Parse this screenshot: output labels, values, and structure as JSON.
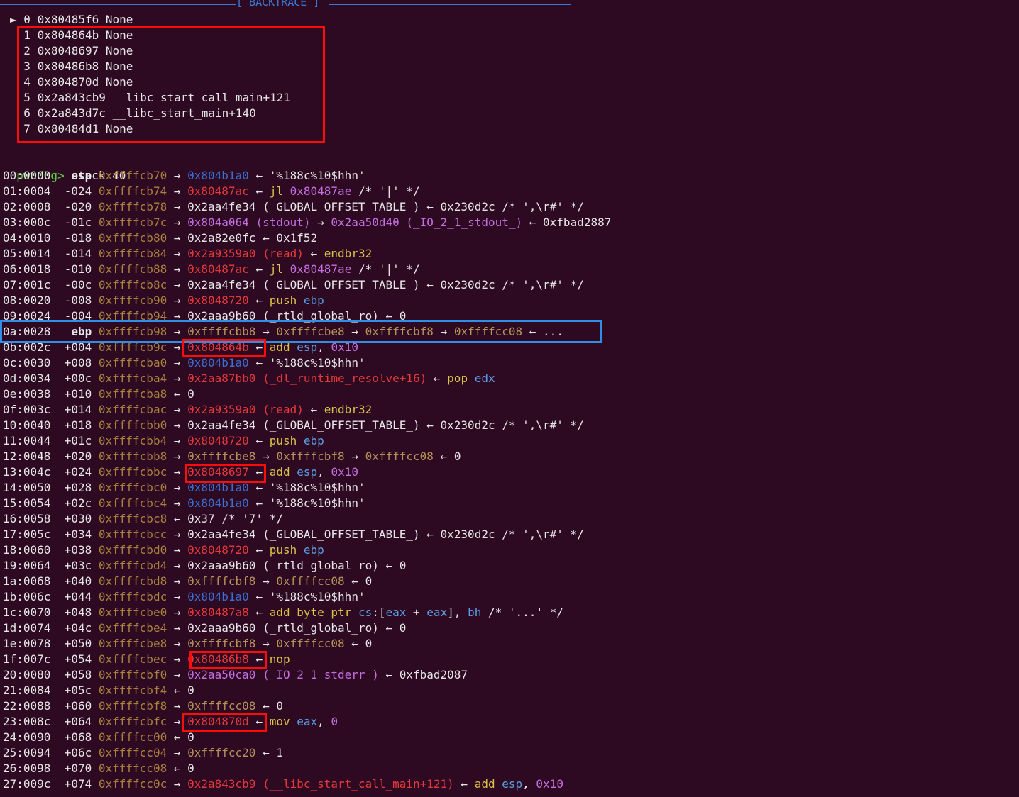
{
  "backtrace": {
    "title": "[ BACKTRACE ]",
    "frames": [
      {
        "marker": "►",
        "index": "0",
        "address": "0x80485f6",
        "symbol": "None"
      },
      {
        "marker": " ",
        "index": "1",
        "address": "0x804864b",
        "symbol": "None"
      },
      {
        "marker": " ",
        "index": "2",
        "address": "0x8048697",
        "symbol": "None"
      },
      {
        "marker": " ",
        "index": "3",
        "address": "0x80486b8",
        "symbol": "None"
      },
      {
        "marker": " ",
        "index": "4",
        "address": "0x804870d",
        "symbol": "None"
      },
      {
        "marker": " ",
        "index": "5",
        "address": "0x2a843cb9",
        "symbol": "__libc_start_call_main+121"
      },
      {
        "marker": " ",
        "index": "6",
        "address": "0x2a843d7c",
        "symbol": "__libc_start_main+140"
      },
      {
        "marker": " ",
        "index": "7",
        "address": "0x80484d1",
        "symbol": "None"
      }
    ]
  },
  "prompt": {
    "text": "pwndbg>",
    "command": "stack 40"
  },
  "stack": [
    {
      "idx": "00:0000",
      "off": " esp",
      "addr": "0xffffcb70",
      "rest": [
        [
          "a",
          "→ "
        ],
        [
          "d",
          "0x804b1a0"
        ],
        [
          "a",
          " ← "
        ],
        [
          "w",
          "'%188c%10$hhn'"
        ]
      ]
    },
    {
      "idx": "01:0004",
      "off": "-024",
      "addr": "0xffffcb74",
      "rest": [
        [
          "a",
          "→ "
        ],
        [
          "r",
          "0x80487ac"
        ],
        [
          "a",
          " ← "
        ],
        [
          "y",
          "jl"
        ],
        [
          "w",
          " "
        ],
        [
          "p",
          "0x80487ae"
        ],
        [
          "w",
          " /* '|' */"
        ]
      ]
    },
    {
      "idx": "02:0008",
      "off": "-020",
      "addr": "0xffffcb78",
      "rest": [
        [
          "a",
          "→ "
        ],
        [
          "w",
          "0x2aa4fe34 (_GLOBAL_OFFSET_TABLE_) ← 0x230d2c /* ',\\r#' */"
        ]
      ]
    },
    {
      "idx": "03:000c",
      "off": "-01c",
      "addr": "0xffffcb7c",
      "rest": [
        [
          "a",
          "→ "
        ],
        [
          "p",
          "0x804a064 (stdout)"
        ],
        [
          "a",
          " → "
        ],
        [
          "p",
          "0x2aa50d40 (_IO_2_1_stdout_)"
        ],
        [
          "a",
          " ← "
        ],
        [
          "w",
          "0xfbad2887"
        ]
      ]
    },
    {
      "idx": "04:0010",
      "off": "-018",
      "addr": "0xffffcb80",
      "rest": [
        [
          "a",
          "→ "
        ],
        [
          "w",
          "0x2a82e0fc ← 0x1f52"
        ]
      ]
    },
    {
      "idx": "05:0014",
      "off": "-014",
      "addr": "0xffffcb84",
      "rest": [
        [
          "a",
          "→ "
        ],
        [
          "r",
          "0x2a9359a0 (read)"
        ],
        [
          "a",
          " ← "
        ],
        [
          "y",
          "endbr32"
        ]
      ]
    },
    {
      "idx": "06:0018",
      "off": "-010",
      "addr": "0xffffcb88",
      "rest": [
        [
          "a",
          "→ "
        ],
        [
          "r",
          "0x80487ac"
        ],
        [
          "a",
          " ← "
        ],
        [
          "y",
          "jl"
        ],
        [
          "w",
          " "
        ],
        [
          "p",
          "0x80487ae"
        ],
        [
          "w",
          " /* '|' */"
        ]
      ]
    },
    {
      "idx": "07:001c",
      "off": "-00c",
      "addr": "0xffffcb8c",
      "rest": [
        [
          "a",
          "→ "
        ],
        [
          "w",
          "0x2aa4fe34 (_GLOBAL_OFFSET_TABLE_) ← 0x230d2c /* ',\\r#' */"
        ]
      ]
    },
    {
      "idx": "08:0020",
      "off": "-008",
      "addr": "0xffffcb90",
      "rest": [
        [
          "a",
          "→ "
        ],
        [
          "r",
          "0x8048720"
        ],
        [
          "a",
          " ← "
        ],
        [
          "y",
          "push"
        ],
        [
          "w",
          " "
        ],
        [
          "b",
          "ebp"
        ]
      ]
    },
    {
      "idx": "09:0024",
      "off": "-004",
      "addr": "0xffffcb94",
      "rest": [
        [
          "a",
          "→ "
        ],
        [
          "w",
          "0x2aaa9b60 (_rtld_global_ro) ← 0"
        ]
      ]
    },
    {
      "idx": "0a:0028",
      "off": " ebp",
      "addr": "0xffffcb98",
      "rest": [
        [
          "a",
          "→ "
        ],
        [
          "s",
          "0xffffcbb8"
        ],
        [
          "a",
          " → "
        ],
        [
          "s",
          "0xffffcbe8"
        ],
        [
          "a",
          " → "
        ],
        [
          "s",
          "0xffffcbf8"
        ],
        [
          "a",
          " → "
        ],
        [
          "s",
          "0xffffcc08"
        ],
        [
          "a",
          " ← "
        ],
        [
          "w",
          "..."
        ]
      ]
    },
    {
      "idx": "0b:002c",
      "off": "+004",
      "addr": "0xffffcb9c",
      "rest": [
        [
          "a",
          "→ "
        ],
        [
          "r",
          "0x804864b"
        ],
        [
          "a",
          " ← "
        ],
        [
          "y",
          "add"
        ],
        [
          "w",
          " "
        ],
        [
          "b",
          "esp"
        ],
        [
          "w",
          ", "
        ],
        [
          "p",
          "0x10"
        ]
      ]
    },
    {
      "idx": "0c:0030",
      "off": "+008",
      "addr": "0xffffcba0",
      "rest": [
        [
          "a",
          "→ "
        ],
        [
          "d",
          "0x804b1a0"
        ],
        [
          "a",
          " ← "
        ],
        [
          "w",
          "'%188c%10$hhn'"
        ]
      ]
    },
    {
      "idx": "0d:0034",
      "off": "+00c",
      "addr": "0xffffcba4",
      "rest": [
        [
          "a",
          "→ "
        ],
        [
          "r",
          "0x2aa87bb0 (_dl_runtime_resolve+16)"
        ],
        [
          "a",
          " ← "
        ],
        [
          "y",
          "pop"
        ],
        [
          "w",
          " "
        ],
        [
          "b",
          "edx"
        ]
      ]
    },
    {
      "idx": "0e:0038",
      "off": "+010",
      "addr": "0xffffcba8",
      "rest": [
        [
          "a",
          "← "
        ],
        [
          "w",
          "0"
        ]
      ]
    },
    {
      "idx": "0f:003c",
      "off": "+014",
      "addr": "0xffffcbac",
      "rest": [
        [
          "a",
          "→ "
        ],
        [
          "r",
          "0x2a9359a0 (read)"
        ],
        [
          "a",
          " ← "
        ],
        [
          "y",
          "endbr32"
        ]
      ]
    },
    {
      "idx": "10:0040",
      "off": "+018",
      "addr": "0xffffcbb0",
      "rest": [
        [
          "a",
          "→ "
        ],
        [
          "w",
          "0x2aa4fe34 (_GLOBAL_OFFSET_TABLE_) ← 0x230d2c /* ',\\r#' */"
        ]
      ]
    },
    {
      "idx": "11:0044",
      "off": "+01c",
      "addr": "0xffffcbb4",
      "rest": [
        [
          "a",
          "→ "
        ],
        [
          "r",
          "0x8048720"
        ],
        [
          "a",
          " ← "
        ],
        [
          "y",
          "push"
        ],
        [
          "w",
          " "
        ],
        [
          "b",
          "ebp"
        ]
      ]
    },
    {
      "idx": "12:0048",
      "off": "+020",
      "addr": "0xffffcbb8",
      "rest": [
        [
          "a",
          "→ "
        ],
        [
          "s",
          "0xffffcbe8"
        ],
        [
          "a",
          " → "
        ],
        [
          "s",
          "0xffffcbf8"
        ],
        [
          "a",
          " → "
        ],
        [
          "s",
          "0xffffcc08"
        ],
        [
          "a",
          " ← "
        ],
        [
          "w",
          "0"
        ]
      ]
    },
    {
      "idx": "13:004c",
      "off": "+024",
      "addr": "0xffffcbbc",
      "rest": [
        [
          "a",
          "→ "
        ],
        [
          "r",
          "0x8048697"
        ],
        [
          "a",
          " ← "
        ],
        [
          "y",
          "add"
        ],
        [
          "w",
          " "
        ],
        [
          "b",
          "esp"
        ],
        [
          "w",
          ", "
        ],
        [
          "p",
          "0x10"
        ]
      ]
    },
    {
      "idx": "14:0050",
      "off": "+028",
      "addr": "0xffffcbc0",
      "rest": [
        [
          "a",
          "→ "
        ],
        [
          "d",
          "0x804b1a0"
        ],
        [
          "a",
          " ← "
        ],
        [
          "w",
          "'%188c%10$hhn'"
        ]
      ]
    },
    {
      "idx": "15:0054",
      "off": "+02c",
      "addr": "0xffffcbc4",
      "rest": [
        [
          "a",
          "→ "
        ],
        [
          "d",
          "0x804b1a0"
        ],
        [
          "a",
          " ← "
        ],
        [
          "w",
          "'%188c%10$hhn'"
        ]
      ]
    },
    {
      "idx": "16:0058",
      "off": "+030",
      "addr": "0xffffcbc8",
      "rest": [
        [
          "a",
          "← "
        ],
        [
          "w",
          "0x37 /* '7' */"
        ]
      ]
    },
    {
      "idx": "17:005c",
      "off": "+034",
      "addr": "0xffffcbcc",
      "rest": [
        [
          "a",
          "→ "
        ],
        [
          "w",
          "0x2aa4fe34 (_GLOBAL_OFFSET_TABLE_) ← 0x230d2c /* ',\\r#' */"
        ]
      ]
    },
    {
      "idx": "18:0060",
      "off": "+038",
      "addr": "0xffffcbd0",
      "rest": [
        [
          "a",
          "→ "
        ],
        [
          "r",
          "0x8048720"
        ],
        [
          "a",
          " ← "
        ],
        [
          "y",
          "push"
        ],
        [
          "w",
          " "
        ],
        [
          "b",
          "ebp"
        ]
      ]
    },
    {
      "idx": "19:0064",
      "off": "+03c",
      "addr": "0xffffcbd4",
      "rest": [
        [
          "a",
          "→ "
        ],
        [
          "w",
          "0x2aaa9b60 (_rtld_global_ro) ← 0"
        ]
      ]
    },
    {
      "idx": "1a:0068",
      "off": "+040",
      "addr": "0xffffcbd8",
      "rest": [
        [
          "a",
          "→ "
        ],
        [
          "s",
          "0xffffcbf8"
        ],
        [
          "a",
          " → "
        ],
        [
          "s",
          "0xffffcc08"
        ],
        [
          "a",
          " ← "
        ],
        [
          "w",
          "0"
        ]
      ]
    },
    {
      "idx": "1b:006c",
      "off": "+044",
      "addr": "0xffffcbdc",
      "rest": [
        [
          "a",
          "→ "
        ],
        [
          "d",
          "0x804b1a0"
        ],
        [
          "a",
          " ← "
        ],
        [
          "w",
          "'%188c%10$hhn'"
        ]
      ]
    },
    {
      "idx": "1c:0070",
      "off": "+048",
      "addr": "0xffffcbe0",
      "rest": [
        [
          "a",
          "→ "
        ],
        [
          "r",
          "0x80487a8"
        ],
        [
          "a",
          " ← "
        ],
        [
          "y",
          "add byte ptr"
        ],
        [
          "w",
          " "
        ],
        [
          "b",
          "cs"
        ],
        [
          "w",
          ":["
        ],
        [
          "b",
          "eax"
        ],
        [
          "w",
          " + "
        ],
        [
          "b",
          "eax"
        ],
        [
          "w",
          "], "
        ],
        [
          "b",
          "bh"
        ],
        [
          "w",
          " /* '...' */"
        ]
      ]
    },
    {
      "idx": "1d:0074",
      "off": "+04c",
      "addr": "0xffffcbe4",
      "rest": [
        [
          "a",
          "→ "
        ],
        [
          "w",
          "0x2aaa9b60 (_rtld_global_ro) ← 0"
        ]
      ]
    },
    {
      "idx": "1e:0078",
      "off": "+050",
      "addr": "0xffffcbe8",
      "rest": [
        [
          "a",
          "→ "
        ],
        [
          "s",
          "0xffffcbf8"
        ],
        [
          "a",
          " → "
        ],
        [
          "s",
          "0xffffcc08"
        ],
        [
          "a",
          " ← "
        ],
        [
          "w",
          "0"
        ]
      ]
    },
    {
      "idx": "1f:007c",
      "off": "+054",
      "addr": "0xffffcbec",
      "rest": [
        [
          "a",
          "→ "
        ],
        [
          "r",
          "0x80486b8"
        ],
        [
          "a",
          " ← "
        ],
        [
          "y",
          "nop"
        ]
      ]
    },
    {
      "idx": "20:0080",
      "off": "+058",
      "addr": "0xffffcbf0",
      "rest": [
        [
          "a",
          "→ "
        ],
        [
          "p",
          "0x2aa50ca0 (_IO_2_1_stderr_)"
        ],
        [
          "a",
          " ← "
        ],
        [
          "w",
          "0xfbad2087"
        ]
      ]
    },
    {
      "idx": "21:0084",
      "off": "+05c",
      "addr": "0xffffcbf4",
      "rest": [
        [
          "a",
          "← "
        ],
        [
          "w",
          "0"
        ]
      ]
    },
    {
      "idx": "22:0088",
      "off": "+060",
      "addr": "0xffffcbf8",
      "rest": [
        [
          "a",
          "→ "
        ],
        [
          "s",
          "0xffffcc08"
        ],
        [
          "a",
          " ← "
        ],
        [
          "w",
          "0"
        ]
      ]
    },
    {
      "idx": "23:008c",
      "off": "+064",
      "addr": "0xffffcbfc",
      "rest": [
        [
          "a",
          "→ "
        ],
        [
          "r",
          "0x804870d"
        ],
        [
          "a",
          " ← "
        ],
        [
          "y",
          "mov"
        ],
        [
          "w",
          " "
        ],
        [
          "b",
          "eax"
        ],
        [
          "w",
          ", "
        ],
        [
          "p",
          "0"
        ]
      ]
    },
    {
      "idx": "24:0090",
      "off": "+068",
      "addr": "0xffffcc00",
      "rest": [
        [
          "a",
          "← "
        ],
        [
          "w",
          "0"
        ]
      ]
    },
    {
      "idx": "25:0094",
      "off": "+06c",
      "addr": "0xffffcc04",
      "rest": [
        [
          "a",
          "→ "
        ],
        [
          "s",
          "0xffffcc20"
        ],
        [
          "a",
          " ← "
        ],
        [
          "w",
          "1"
        ]
      ]
    },
    {
      "idx": "26:0098",
      "off": "+070",
      "addr": "0xffffcc08",
      "rest": [
        [
          "a",
          "← "
        ],
        [
          "w",
          "0"
        ]
      ]
    },
    {
      "idx": "27:009c",
      "off": "+074",
      "addr": "0xffffcc0c",
      "rest": [
        [
          "a",
          "→ "
        ],
        [
          "r",
          "0x2a843cb9 (__libc_start_call_main+121)"
        ],
        [
          "a",
          " ← "
        ],
        [
          "y",
          "add"
        ],
        [
          "w",
          " "
        ],
        [
          "b",
          "esp"
        ],
        [
          "w",
          ", "
        ],
        [
          "p",
          "0x10"
        ]
      ]
    }
  ],
  "colors": {
    "background": "#2d0922",
    "highlight_red": "#ff0b0b",
    "highlight_blue": "#2f8fe6",
    "rule_blue": "#3b7bd6"
  }
}
